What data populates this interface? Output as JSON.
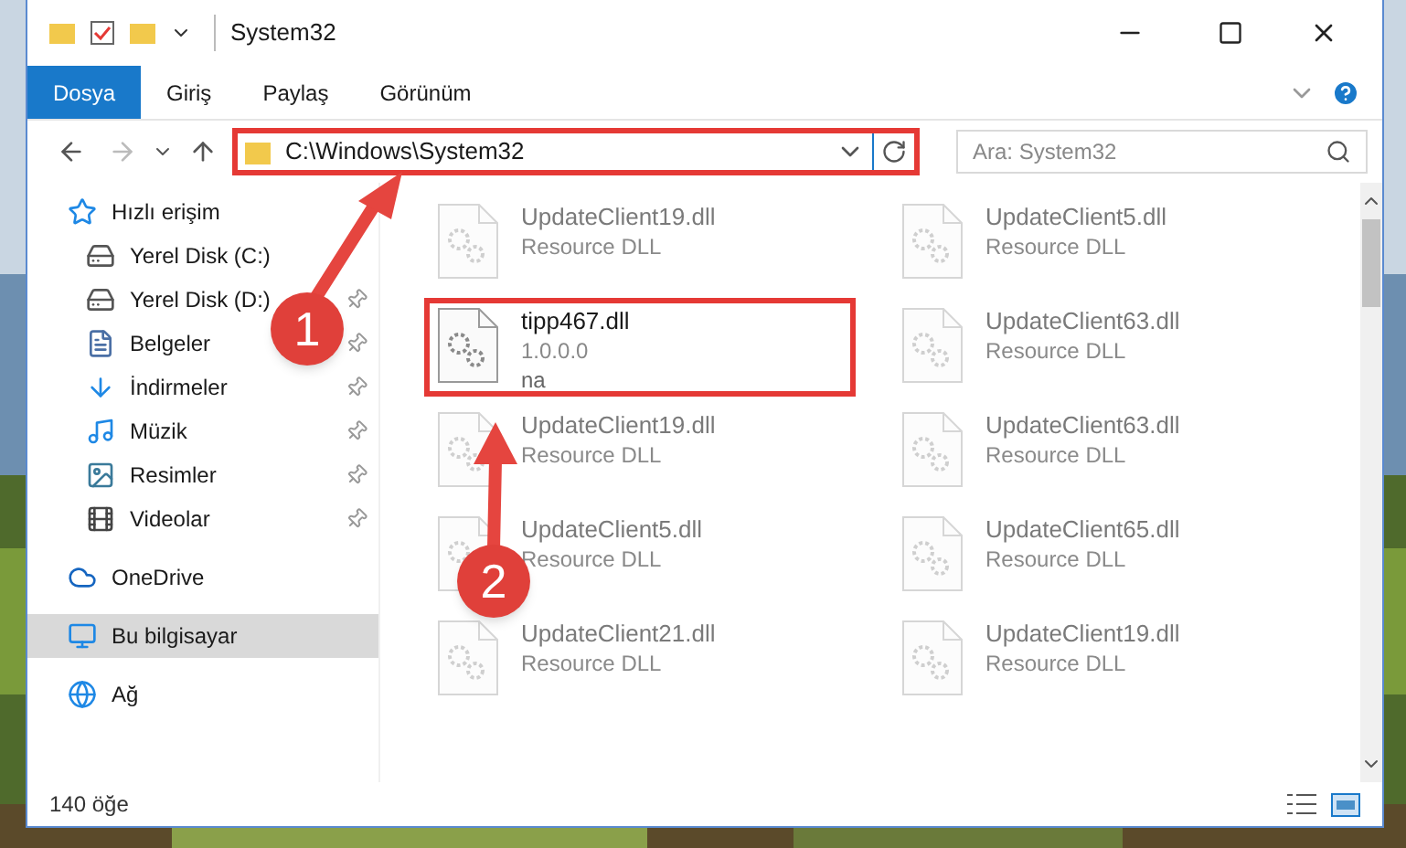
{
  "window": {
    "title": "System32"
  },
  "ribbon_tabs": [
    {
      "label": "Dosya",
      "selected": true
    },
    {
      "label": "Giriş",
      "selected": false
    },
    {
      "label": "Paylaş",
      "selected": false
    },
    {
      "label": "Görünüm",
      "selected": false
    }
  ],
  "address": {
    "path": "C:\\Windows\\System32",
    "highlighted": true
  },
  "search": {
    "placeholder": "Ara: System32"
  },
  "sidebar": {
    "items": [
      {
        "label": "Hızlı erişim",
        "kind": "star",
        "selected": false,
        "children": [
          {
            "label": "Yerel Disk (C:)",
            "kind": "system-drive",
            "pinned": false
          },
          {
            "label": "Yerel Disk (D:)",
            "kind": "drive",
            "pinned": true
          },
          {
            "label": "Belgeler",
            "kind": "document",
            "pinned": true
          },
          {
            "label": "İndirmeler",
            "kind": "download",
            "pinned": true
          },
          {
            "label": "Müzik",
            "kind": "music",
            "pinned": true
          },
          {
            "label": "Resimler",
            "kind": "pictures",
            "pinned": true
          },
          {
            "label": "Videolar",
            "kind": "video",
            "pinned": true
          }
        ]
      },
      {
        "label": "OneDrive",
        "kind": "cloud",
        "selected": false
      },
      {
        "label": "Bu bilgisayar",
        "kind": "computer",
        "selected": true
      },
      {
        "label": "Ağ",
        "kind": "network",
        "selected": false
      }
    ]
  },
  "files": [
    {
      "name": "UpdateClient19.dll",
      "line_2": "Resource DLL",
      "blurred": true,
      "highlighted": false
    },
    {
      "name": "UpdateClient5.dll",
      "line_2": "Resource DLL",
      "blurred": true,
      "highlighted": false
    },
    {
      "name": "tipp467.dll",
      "line_2": "1.0.0.0",
      "line_3": "na",
      "blurred": false,
      "highlighted": true
    },
    {
      "name": "UpdateClient63.dll",
      "line_2": "Resource DLL",
      "blurred": true,
      "highlighted": false
    },
    {
      "name": "UpdateClient19.dll",
      "line_2": "Resource DLL",
      "blurred": true,
      "highlighted": false
    },
    {
      "name": "UpdateClient63.dll",
      "line_2": "Resource DLL",
      "blurred": true,
      "highlighted": false
    },
    {
      "name": "UpdateClient5.dll",
      "line_2": "Resource DLL",
      "blurred": true,
      "highlighted": false
    },
    {
      "name": "UpdateClient65.dll",
      "line_2": "Resource DLL",
      "blurred": true,
      "highlighted": false
    },
    {
      "name": "UpdateClient21.dll",
      "line_2": "Resource DLL",
      "blurred": true,
      "highlighted": false
    },
    {
      "name": "UpdateClient19.dll",
      "line_2": "Resource DLL",
      "blurred": true,
      "highlighted": false
    }
  ],
  "status_bar": {
    "count": "140 öğe"
  },
  "annotations": [
    {
      "number": "1"
    },
    {
      "number": "2"
    }
  ]
}
